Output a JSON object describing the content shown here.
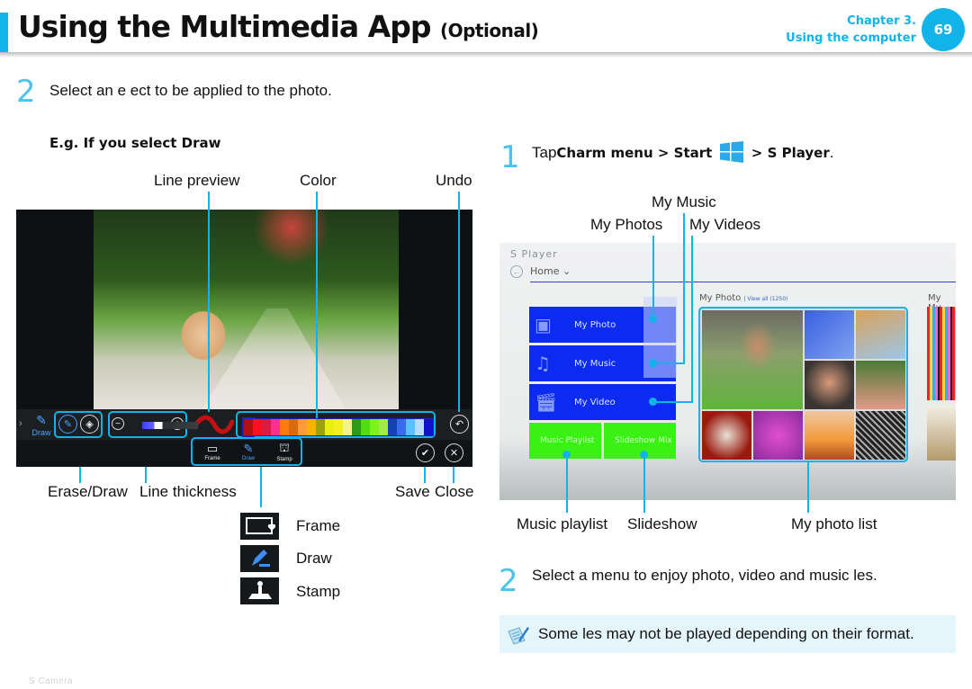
{
  "header": {
    "title": "Using the Multimedia App",
    "title_suffix": "(Optional)",
    "chapter": "Chapter 3.",
    "chapter_name": "Using the computer",
    "page_number": "69",
    "accent_color": "#12b3e8"
  },
  "left": {
    "step_number": "2",
    "step_text": "Select an e ect to be applied to the photo.",
    "subheading": "E.g. If you select Draw",
    "callouts_top": [
      "Line preview",
      "Color",
      "Undo"
    ],
    "callouts_bottom": [
      "Erase/Draw",
      "Line thickness",
      "Save",
      "Close"
    ],
    "screenshot": {
      "app_name": "S Camera",
      "side_tool_label": "Draw",
      "tools": [
        {
          "label": "Frame",
          "icon": "frame-icon",
          "active": false
        },
        {
          "label": "Draw",
          "icon": "draw-icon",
          "active": true
        },
        {
          "label": "Stamp",
          "icon": "stamp-icon",
          "active": false
        }
      ],
      "palette": [
        "#b30f0f",
        "#ff1020",
        "#d81a44",
        "#ff2f8a",
        "#ff7a10",
        "#d96a12",
        "#ff9a3a",
        "#ffb300",
        "#9aa30f",
        "#e9ee12",
        "#f2f020",
        "#f4f28a",
        "#2f9a1a",
        "#52dd13",
        "#7df21a",
        "#a0ea4a",
        "#1342b4",
        "#3a6af0",
        "#5ac0ff",
        "#b6dcff",
        "#1111cc"
      ],
      "thickness_level": 0.35
    },
    "legend": [
      {
        "icon": "frame-icon",
        "label": "Frame"
      },
      {
        "icon": "draw-icon",
        "label": "Draw"
      },
      {
        "icon": "stamp-icon",
        "label": "Stamp"
      }
    ]
  },
  "right": {
    "step1_number": "1",
    "step1_prefix": "Tap",
    "step1_path": "Charm menu > Start",
    "step1_suffix": "> S Player",
    "step1_end": ".",
    "callouts_top": [
      "My Music",
      "My Photos",
      "My Videos"
    ],
    "callouts_bottom": [
      "Music playlist",
      "Slideshow",
      "My photo list"
    ],
    "screenshot": {
      "app_name": "S Player",
      "nav_label": "Home",
      "tiles": [
        "My Photo",
        "My Music",
        "My Video"
      ],
      "green_tiles": [
        "Music Playlist",
        "Slideshow Mix"
      ],
      "photo_section": "My Photo",
      "view_all": "| View all (1250)",
      "music_section": "My Mu"
    },
    "step2_number": "2",
    "step2_text": "Select a menu to enjoy photo, video and music  les.",
    "note_text": "Some  les may not be played depending on their format."
  }
}
